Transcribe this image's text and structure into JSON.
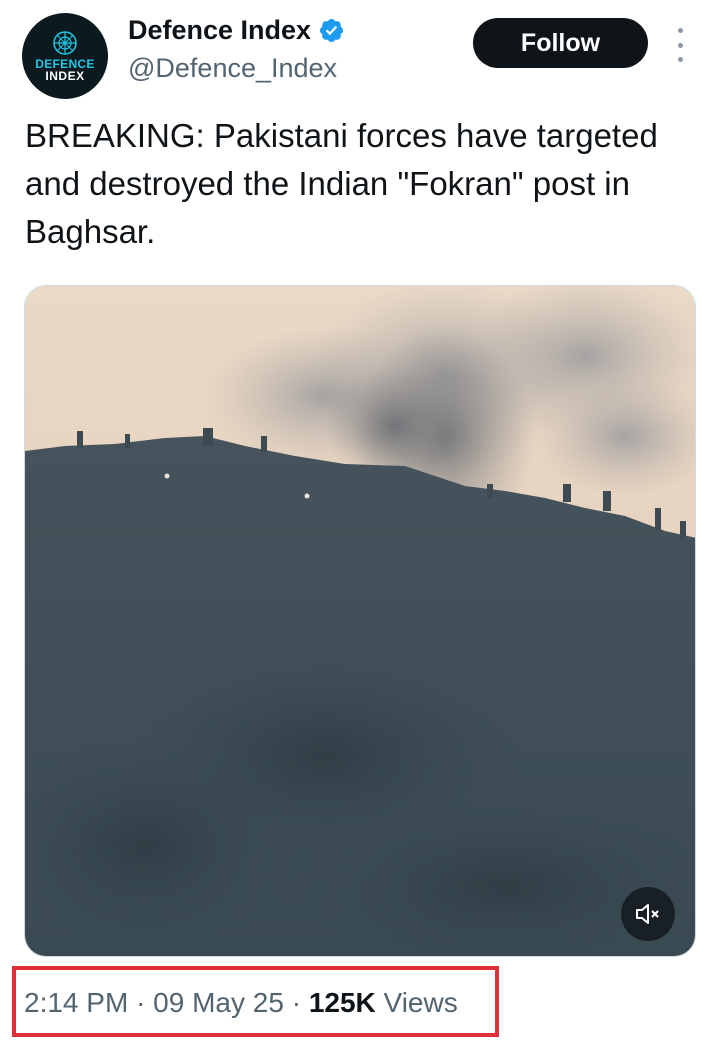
{
  "account": {
    "display_name": "Defence Index",
    "handle": "@Defence_Index",
    "verified": true,
    "avatar_text_line1": "DEFENCE",
    "avatar_text_line2": "INDEX"
  },
  "actions": {
    "follow_label": "Follow"
  },
  "tweet": {
    "text": "BREAKING: Pakistani forces have targeted and destroyed the Indian \"Fokran\" post in Baghsar."
  },
  "media": {
    "type": "video",
    "description_icon": "mute-icon"
  },
  "meta": {
    "time": "2:14 PM",
    "separator": "·",
    "date": "09 May 25",
    "views_count": "125K",
    "views_label": "Views"
  },
  "colors": {
    "accent_verified": "#1d9bf0",
    "highlight_box": "#e0313a",
    "button_bg": "#0f1419",
    "secondary_text": "#536471"
  }
}
